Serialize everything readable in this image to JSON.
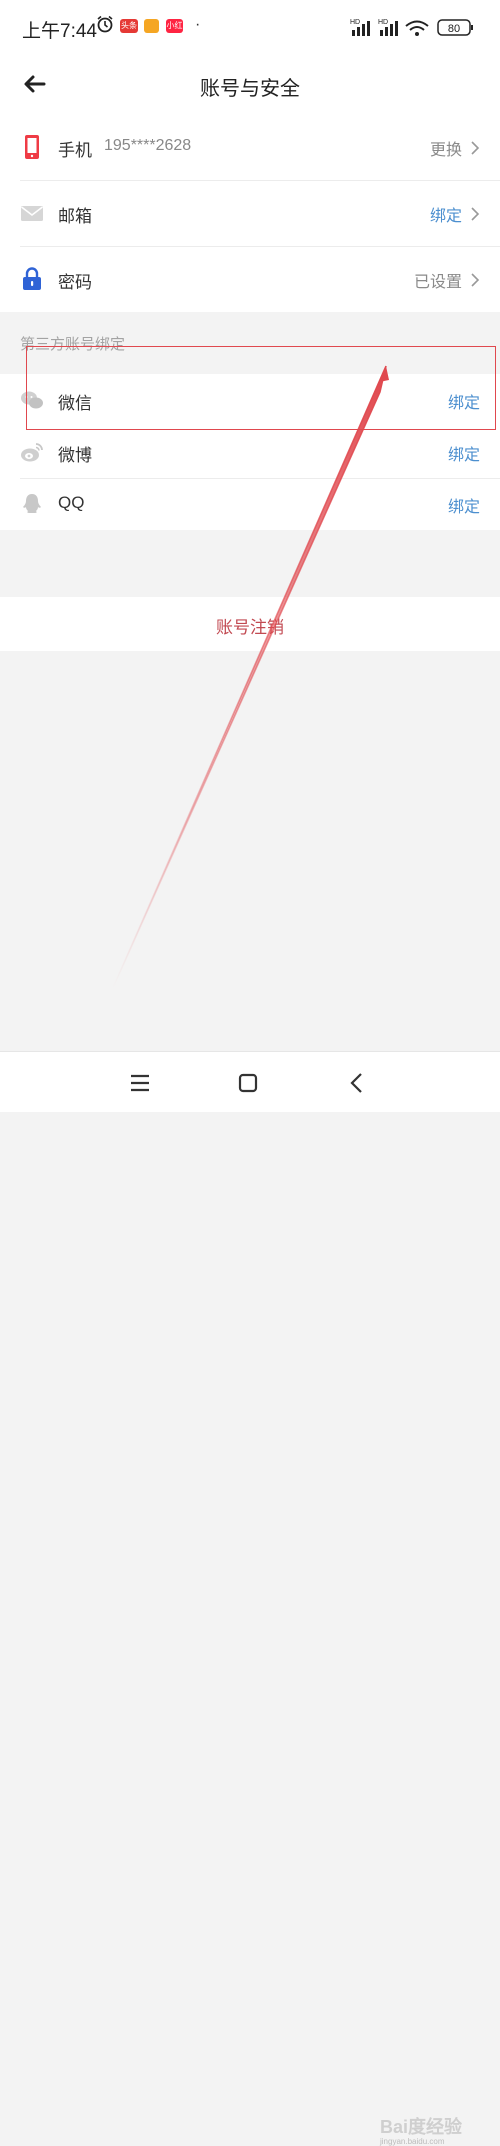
{
  "status_bar": {
    "time": "上午7:44",
    "apps": [
      "头条",
      "",
      "小红书"
    ],
    "signal": "HD",
    "battery": "80"
  },
  "header": {
    "title": "账号与安全"
  },
  "account": {
    "phone": {
      "label": "手机",
      "value": "195****2628",
      "action": "更换"
    },
    "email": {
      "label": "邮箱",
      "action": "绑定"
    },
    "password": {
      "label": "密码",
      "action": "已设置"
    }
  },
  "third_party": {
    "section_label": "第三方账号绑定",
    "items": [
      {
        "label": "微信",
        "action": "绑定"
      },
      {
        "label": "微博",
        "action": "绑定"
      },
      {
        "label": "QQ",
        "action": "绑定"
      }
    ]
  },
  "logout_label": "账号注销",
  "watermark": {
    "main": "Bai度经验",
    "sub": "jingyan.baidu.com"
  },
  "colors": {
    "accent_blue": "#4c8fcf",
    "danger_red": "#c24a52",
    "annotation_red": "#e0484e"
  }
}
